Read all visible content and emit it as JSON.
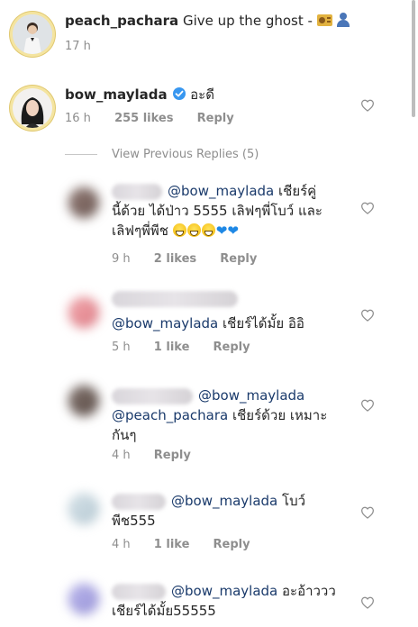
{
  "comments": [
    {
      "username": "peach_pachara",
      "text": "Give up the ghost -",
      "emojis": [
        "radio-icon",
        "bust-silhouette-icon"
      ],
      "time": "17 h"
    },
    {
      "username": "bow_maylada",
      "verified": true,
      "text": "อะดี",
      "time": "16 h",
      "likes": "255 likes",
      "reply": "Reply"
    }
  ],
  "view_previous": "View Previous Replies (5)",
  "replies": [
    {
      "mention": "@bow_maylada",
      "text_line1": "เชียร์คู่",
      "text_line2": "นี้ด้วย ได้ป่าว 5555 เลิฟๆพี่โบว์ และ",
      "text_line3": "เลิฟๆพี่พีช",
      "time": "9 h",
      "likes": "2 likes",
      "reply": "Reply"
    },
    {
      "mention": "@bow_maylada",
      "text": "เชียร์ได้มั้ย อิอิ",
      "time": "5 h",
      "likes": "1 like",
      "reply": "Reply"
    },
    {
      "mention": "@bow_maylada",
      "mention2": "@peach_pachara",
      "text_line2": "เชียร์ด้วย เหมาะ",
      "text_line3": "กันๆ",
      "time": "4 h",
      "reply": "Reply"
    },
    {
      "mention": "@bow_maylada",
      "text_line1": "โบว์",
      "text_line2": "พีช555",
      "time": "4 h",
      "likes": "1 like",
      "reply": "Reply"
    },
    {
      "mention": "@bow_maylada",
      "text_line1": "อะอ้าววว",
      "text_line2": "เชียร์ได้มั้ย55555"
    }
  ],
  "colors": {
    "text": "#262626",
    "meta": "#8e8e8e",
    "verified": "#3897f0",
    "mention": "#1a3a6b"
  }
}
